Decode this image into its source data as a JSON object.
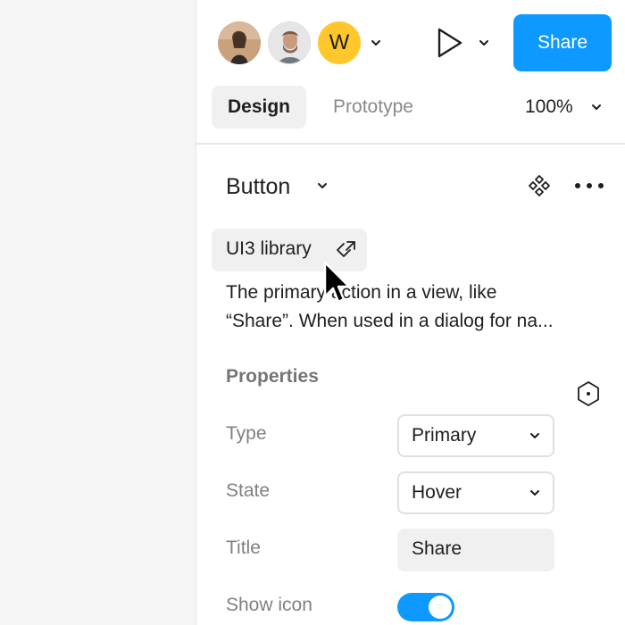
{
  "header": {
    "avatars": [
      {
        "name": "collaborator-photo-1"
      },
      {
        "name": "collaborator-photo-2"
      },
      {
        "letter": "W",
        "color": "#ffc72c"
      }
    ],
    "share_label": "Share",
    "accent_color": "#0d99ff"
  },
  "tabs": [
    {
      "label": "Design",
      "active": true
    },
    {
      "label": "Prototype",
      "active": false
    }
  ],
  "zoom": "100%",
  "component": {
    "title": "Button",
    "library": "UI3 library",
    "description_line1": "The primary action in a view, like",
    "description_line2": "“Share”. When used in a dialog for na..."
  },
  "properties": {
    "section_label": "Properties",
    "type": {
      "label": "Type",
      "value": "Primary"
    },
    "state": {
      "label": "State",
      "value": "Hover"
    },
    "title": {
      "label": "Title",
      "value": "Share"
    },
    "show_icon": {
      "label": "Show icon",
      "on": true
    }
  },
  "icons": [
    "chevron-down-icon",
    "play-icon",
    "component-icon",
    "more-icon",
    "component-link-icon",
    "instance-properties-icon",
    "mouse-cursor-icon"
  ]
}
